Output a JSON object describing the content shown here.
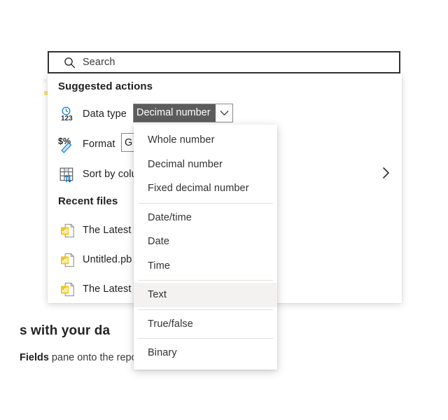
{
  "background": {
    "heading_fragment": "s with your da",
    "paragraph_bold": "Fields",
    "paragraph_rest": " pane onto the report canvas.",
    "edge_fragment": "n . s . J . x"
  },
  "search": {
    "placeholder": "Search",
    "value": "",
    "icon": "search-icon"
  },
  "suggested": {
    "title": "Suggested actions",
    "actions": [
      {
        "label": "Data type",
        "icon": "clock-123-icon"
      },
      {
        "label": "Format",
        "icon": "dollar-percent-pen-icon"
      },
      {
        "label": "Sort by colu",
        "icon": "sort-table-icon"
      }
    ],
    "data_type_combo": {
      "value": "Decimal number",
      "caret_icon": "chevron-down-icon",
      "expanded": true
    },
    "format_field": {
      "value": "G",
      "placeholder": "General"
    },
    "more_icon": "chevron-right-icon"
  },
  "recent": {
    "title": "Recent files",
    "files": [
      {
        "label": "The Latest I",
        "icon": "powerbi-file-icon"
      },
      {
        "label": "Untitled.pb",
        "icon": "powerbi-file-icon"
      },
      {
        "label": "The Latest (",
        "icon": "powerbi-file-icon"
      }
    ]
  },
  "dropdown": {
    "highlighted": "Text",
    "items": [
      {
        "label": "Whole number",
        "selected": false,
        "separator_after": false
      },
      {
        "label": "Decimal number",
        "selected": false,
        "separator_after": false
      },
      {
        "label": "Fixed decimal number",
        "selected": false,
        "separator_after": true
      },
      {
        "label": "Date/time",
        "selected": false,
        "separator_after": false
      },
      {
        "label": "Date",
        "selected": false,
        "separator_after": false
      },
      {
        "label": "Time",
        "selected": false,
        "separator_after": true
      },
      {
        "label": "Text",
        "selected": true,
        "separator_after": true
      },
      {
        "label": "True/false",
        "selected": false,
        "separator_after": true
      },
      {
        "label": "Binary",
        "selected": false,
        "separator_after": false
      }
    ]
  },
  "colors": {
    "accent_yellow": "#f2c811",
    "accent_blue": "#0078d4",
    "selection_gray": "#5c5c5c",
    "hover_gray": "#f3f2f1",
    "border_dark": "#323130"
  }
}
